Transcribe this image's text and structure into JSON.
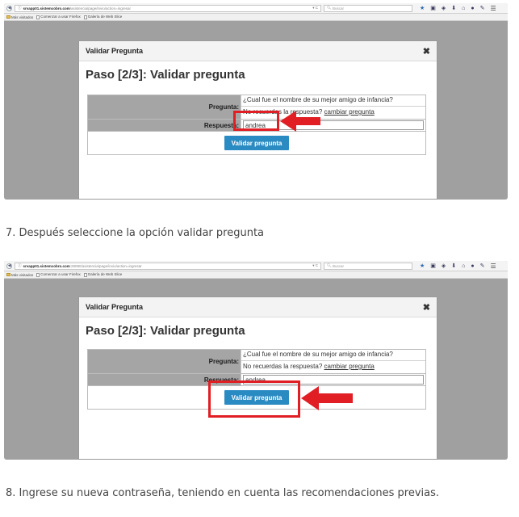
{
  "browser": {
    "url_host": "srvapp01.sistemcobro.com",
    "url_path_1": "/asistencia/page/invio/action=ingresar",
    "url_path_2": ":28080/asistencia/page/invio/action=ingresar",
    "search_placeholder": "Buscar",
    "bookmarks": [
      "Más visitados",
      "Comenzar a usar Firefox",
      "Galería de Web Slice"
    ]
  },
  "dialog": {
    "header": "Validar Pregunta",
    "close_glyph": "✖",
    "title": "Paso [2/3]: Validar pregunta",
    "question_label": "Pregunta:",
    "question_text": "¿Cual fue el nombre de su mejor amigo de infancia?",
    "hint_text": "No recuerdas la respuesta?",
    "hint_link": "cambiar pregunta",
    "answer_label": "Respuesta:",
    "answer_value": "andrea",
    "submit_label": "Validar pregunta"
  },
  "captions": {
    "step7": "7. Después seleccione la opción validar pregunta",
    "step8": "8. Ingrese su nueva contraseña, teniendo en cuenta las recomendaciones previas."
  },
  "colors": {
    "highlight": "#e01e24",
    "button": "#2a8ac2",
    "label_bg": "#a5a5a5",
    "overlay": "#a0a0a0"
  },
  "icons": [
    "back-icon",
    "lock-icon",
    "reload-icon",
    "search-icon",
    "bookmark-star-icon",
    "reading-list-icon",
    "pocket-icon",
    "download-icon",
    "home-icon",
    "chat-icon",
    "menu-icon",
    "arrow-pointer-icon"
  ]
}
